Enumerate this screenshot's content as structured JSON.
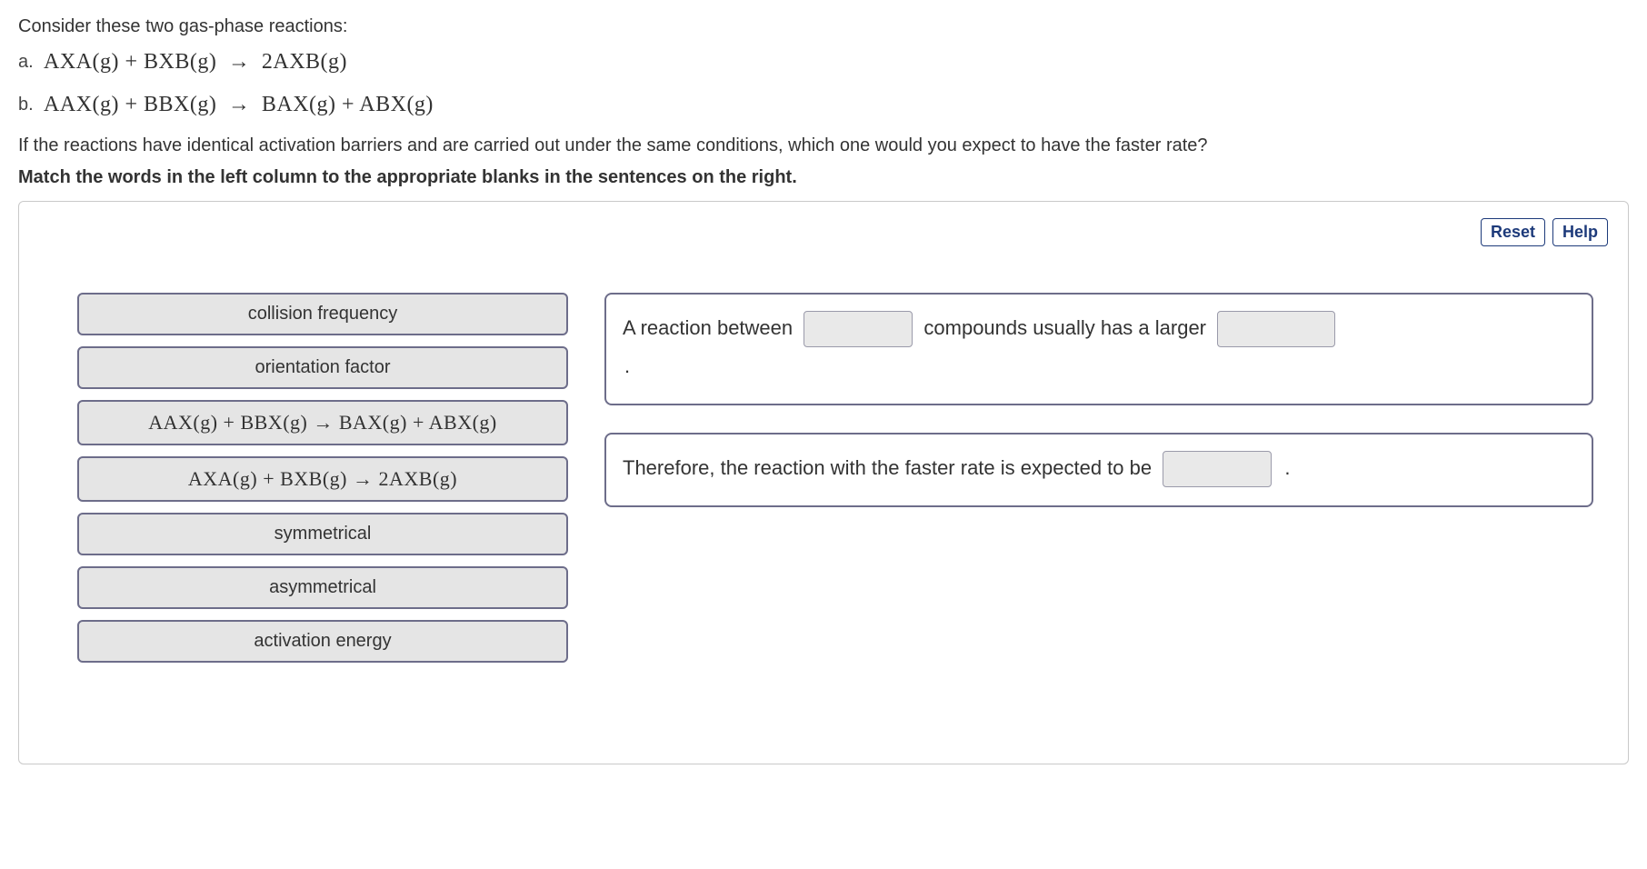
{
  "intro": "Consider these two gas-phase reactions:",
  "items": {
    "a_letter": "a.",
    "b_letter": "b.",
    "a_eqn_lhs1": "AXA(g)",
    "a_eqn_plus": "+",
    "a_eqn_lhs2": "BXB(g)",
    "a_eqn_arrow": "→",
    "a_eqn_rhs": "2AXB(g)",
    "b_eqn_lhs1": "AAX(g)",
    "b_eqn_plus": "+",
    "b_eqn_lhs2": "BBX(g)",
    "b_eqn_arrow": "→",
    "b_eqn_rhs1": "BAX(g)",
    "b_eqn_plus2": "+",
    "b_eqn_rhs2": "ABX(g)"
  },
  "question": "If the reactions have identical activation barriers and are carried out under the same conditions, which one would you expect to have the faster rate?",
  "instruction": "Match the words in the left column to the appropriate blanks in the sentences on the right.",
  "buttons": {
    "reset": "Reset",
    "help": "Help"
  },
  "tiles": [
    {
      "label": "collision frequency",
      "type": "text"
    },
    {
      "label": "orientation factor",
      "type": "text"
    },
    {
      "label": "AAX(g) + BBX(g) → BAX(g) + ABX(g)",
      "type": "eqn"
    },
    {
      "label": "AXA(g) + BXB(g) → 2AXB(g)",
      "type": "eqn"
    },
    {
      "label": "symmetrical",
      "type": "text"
    },
    {
      "label": "asymmetrical",
      "type": "text"
    },
    {
      "label": "activation energy",
      "type": "text"
    }
  ],
  "targets": {
    "card1_pre": "A reaction between",
    "card1_mid": "compounds usually has a larger",
    "card1_end": ".",
    "card2_pre": "Therefore, the reaction with the faster rate is expected to be",
    "card2_end": "."
  }
}
